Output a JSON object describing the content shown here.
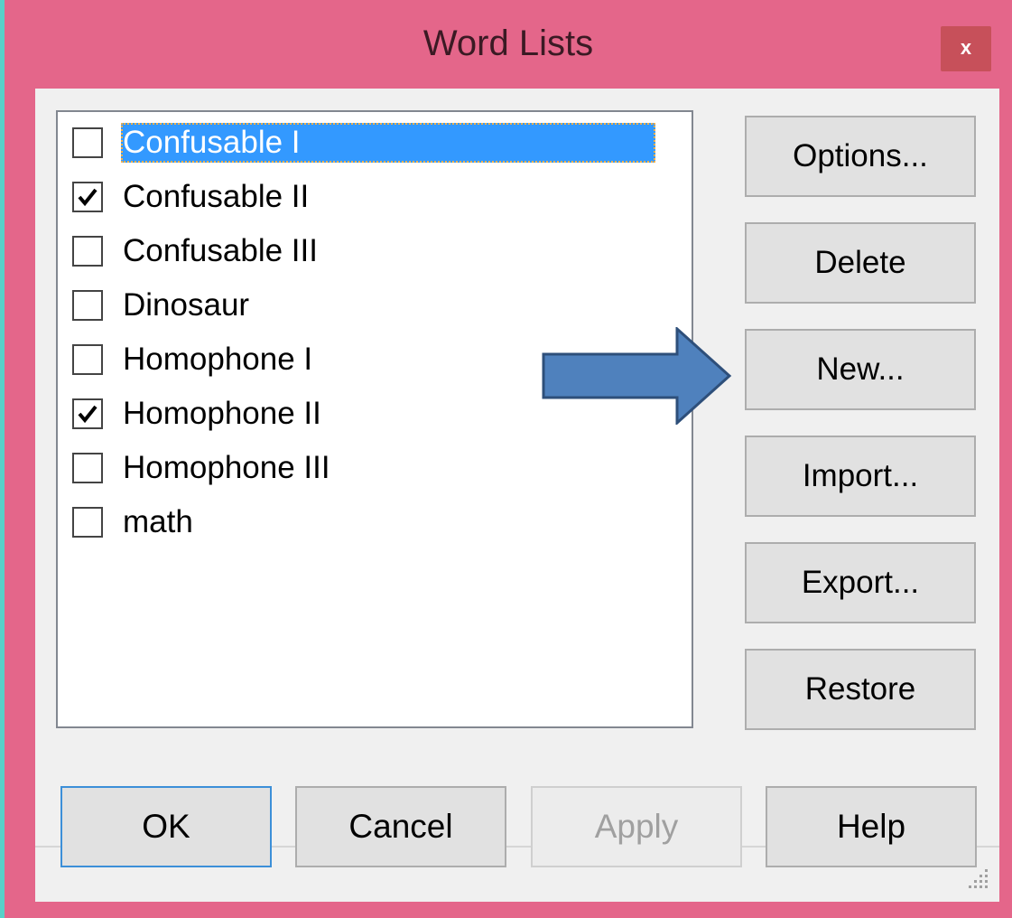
{
  "window": {
    "title": "Word Lists",
    "close_label": "x"
  },
  "word_lists": [
    {
      "label": "Confusable I",
      "checked": false,
      "selected": true
    },
    {
      "label": "Confusable II",
      "checked": true,
      "selected": false
    },
    {
      "label": "Confusable III",
      "checked": false,
      "selected": false
    },
    {
      "label": "Dinosaur",
      "checked": false,
      "selected": false
    },
    {
      "label": "Homophone I",
      "checked": false,
      "selected": false
    },
    {
      "label": "Homophone II",
      "checked": true,
      "selected": false
    },
    {
      "label": "Homophone III",
      "checked": false,
      "selected": false
    },
    {
      "label": "math",
      "checked": false,
      "selected": false
    }
  ],
  "side_buttons": {
    "options": "Options...",
    "delete": "Delete",
    "new": "New...",
    "import": "Import...",
    "export": "Export...",
    "restore": "Restore"
  },
  "bottom_buttons": {
    "ok": "OK",
    "cancel": "Cancel",
    "apply": "Apply",
    "help": "Help"
  },
  "colors": {
    "frame": "#e4668a",
    "selection": "#3399ff",
    "arrow": "#4f81bd"
  }
}
